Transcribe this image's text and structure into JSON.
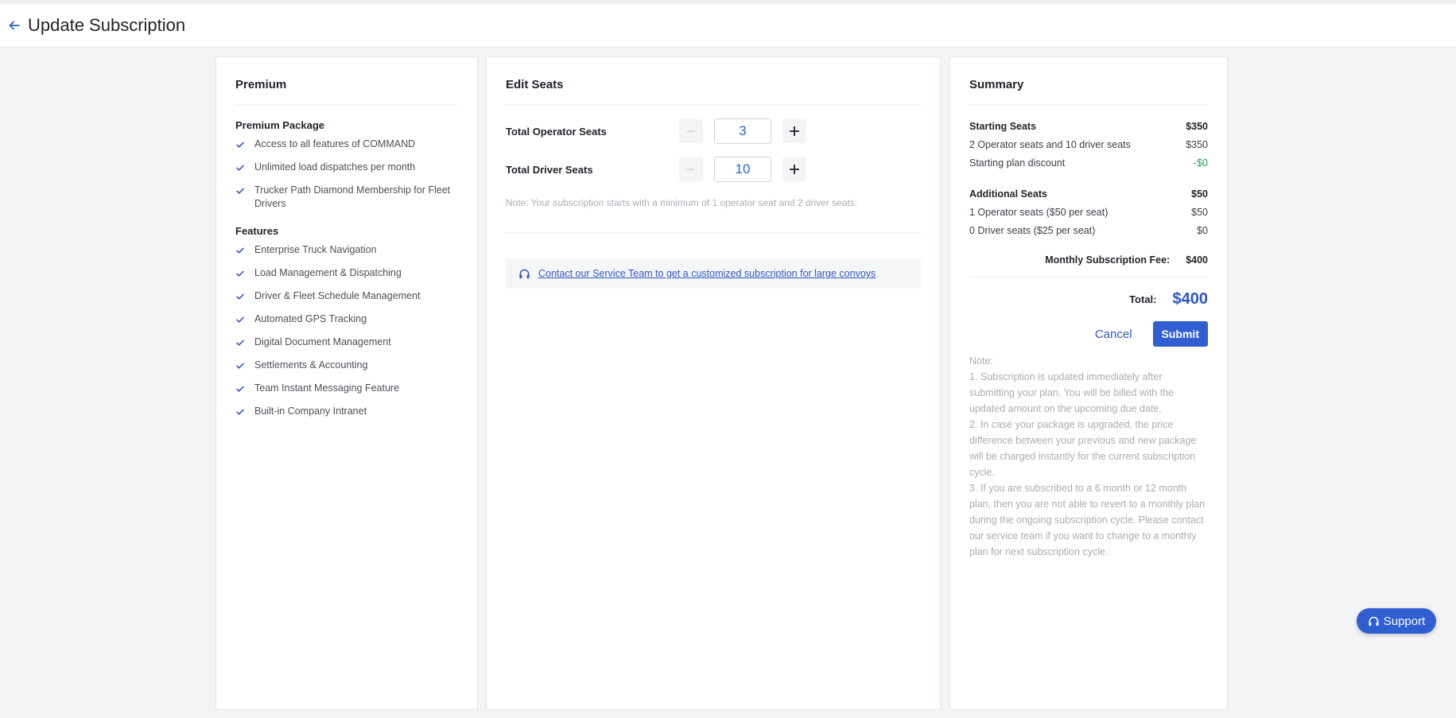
{
  "header": {
    "title": "Update Subscription"
  },
  "premium": {
    "title": "Premium",
    "package_title": "Premium Package",
    "package_items": [
      "Access to all features of COMMAND",
      "Unlimited load dispatches per month",
      "Trucker Path Diamond Membership for Fleet Drivers"
    ],
    "features_title": "Features",
    "features": [
      "Enterprise Truck Navigation",
      "Load Management & Dispatching",
      "Driver & Fleet Schedule Management",
      "Automated GPS Tracking",
      "Digital Document Management",
      "Settlements & Accounting",
      "Team Instant Messaging Feature",
      "Built-in Company Intranet"
    ]
  },
  "seats": {
    "title": "Edit Seats",
    "operator_label": "Total Operator Seats",
    "operator_value": "3",
    "driver_label": "Total Driver Seats",
    "driver_value": "10",
    "note": "Note: Your subscription starts with a minimum of 1 operator seat and 2 driver seats.",
    "contact_link": "Contact our Service Team to get a customized subscription for large convoys"
  },
  "summary": {
    "title": "Summary",
    "starting_label": "Starting Seats",
    "starting_value": "$350",
    "starting_detail_label": "2 Operator seats and 10 driver seats",
    "starting_detail_value": "$350",
    "discount_label": "Starting plan discount",
    "discount_value": "-$0",
    "additional_label": "Additional Seats",
    "additional_value": "$50",
    "op_extra_label": "1 Operator seats ($50 per seat)",
    "op_extra_value": "$50",
    "dr_extra_label": "0 Driver seats ($25 per seat)",
    "dr_extra_value": "$0",
    "fee_label": "Monthly Subscription Fee:",
    "fee_value": "$400",
    "total_label": "Total:",
    "total_value": "$400",
    "cancel_label": "Cancel",
    "submit_label": "Submit",
    "notes": [
      "Note:",
      "1. Subscription is updated immediately after submitting your plan. You will be billed with the updated amount on the upcoming due date.",
      "2. In case your package is upgraded, the price difference between your previous and new package will be charged instantly for the current subscription cycle.",
      "3. If you are subscribed to a 6 month or 12 month plan, then you are not able to revert to a monthly plan during the ongoing subscription cycle. Please contact our service team if you want to change to a monthly plan for next subscription cycle."
    ]
  },
  "support": {
    "label": "Support"
  },
  "colors": {
    "accent": "#2f5fd1",
    "link": "#2f57c4",
    "discount": "#1aa45a"
  }
}
